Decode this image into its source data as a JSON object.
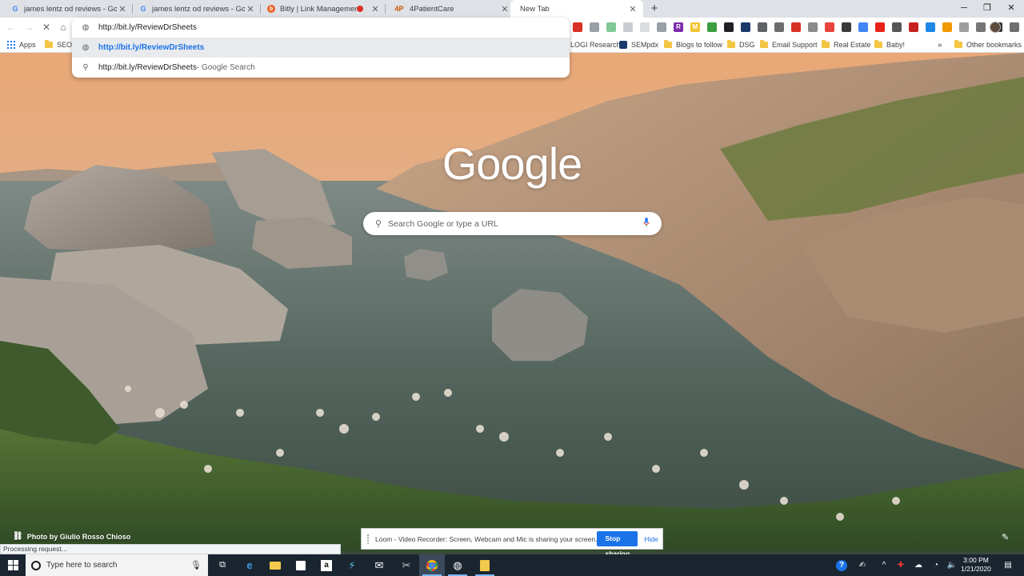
{
  "tabs": [
    {
      "title": "james lentz od reviews - Google S",
      "favicon": "G"
    },
    {
      "title": "james lentz od reviews - Google S",
      "favicon": "G"
    },
    {
      "title": "Bitly | Link Management",
      "favicon": "b"
    },
    {
      "title": "4PatientCare",
      "favicon": "4P"
    },
    {
      "title": "New Tab",
      "favicon": ""
    }
  ],
  "omnibox": {
    "value": "http://bit.ly/ReviewDrSheets",
    "suggestions": [
      {
        "text": "http://bit.ly/ReviewDrSheets",
        "desc": ""
      },
      {
        "text": "http://bit.ly/ReviewDrSheets",
        "desc": " - Google Search"
      }
    ]
  },
  "extensions": [
    {
      "icon": "record-icon",
      "glyph": "",
      "color": "#d93025"
    },
    {
      "icon": "ext-code-icon",
      "glyph": "",
      "color": "#9aa0a6"
    },
    {
      "icon": "ext-audio-icon",
      "glyph": "",
      "color": "#81c995"
    },
    {
      "icon": "ext-zoom-icon",
      "glyph": "",
      "color": "#c8ccd0"
    },
    {
      "icon": "ext-slash-icon",
      "glyph": "",
      "color": "#dadce0"
    },
    {
      "icon": "ext-k-icon",
      "glyph": "",
      "color": "#9aa0a6"
    },
    {
      "icon": "ext-r-icon",
      "glyph": "R",
      "color": "#7b2ca8"
    },
    {
      "icon": "ext-m-icon",
      "glyph": "M",
      "color": "#f1c232"
    },
    {
      "icon": "ext-n-icon",
      "glyph": "",
      "color": "#3d9c40"
    },
    {
      "icon": "ext-page-icon",
      "glyph": "",
      "color": "#202124"
    },
    {
      "icon": "ext-monitor-icon",
      "glyph": "",
      "color": "#1a3a6b"
    },
    {
      "icon": "ext-lock-icon",
      "glyph": "",
      "color": "#5f6368"
    },
    {
      "icon": "ext-circle-icon",
      "glyph": "",
      "color": "#6d6d6d"
    },
    {
      "icon": "ext-stop-icon",
      "glyph": "",
      "color": "#d93025"
    },
    {
      "icon": "ext-g-icon",
      "glyph": "",
      "color": "#8a8a8a"
    },
    {
      "icon": "ext-puzzle-icon",
      "glyph": "",
      "color": "#e8453c"
    },
    {
      "icon": "ext-ring-icon",
      "glyph": "",
      "color": "#3a3a3a"
    },
    {
      "icon": "ext-cloud-icon",
      "glyph": "",
      "color": "#4285f4"
    },
    {
      "icon": "ext-youtube-icon",
      "glyph": "",
      "color": "#e62117"
    },
    {
      "icon": "ext-box-icon",
      "glyph": "",
      "color": "#555555"
    },
    {
      "icon": "ext-chrome-icon",
      "glyph": "",
      "color": "#c5221f"
    },
    {
      "icon": "ext-blue-icon",
      "glyph": "",
      "color": "#1e88e5"
    },
    {
      "icon": "ext-gear-icon",
      "glyph": "",
      "color": "#f29900"
    },
    {
      "icon": "ext-grey-icon",
      "glyph": "",
      "color": "#9e9e9e"
    },
    {
      "icon": "ext-photo-icon",
      "glyph": "",
      "color": "#757575"
    },
    {
      "icon": "ext-frame-icon",
      "glyph": "",
      "color": "#303030"
    },
    {
      "icon": "ext-last-icon",
      "glyph": "",
      "color": "#6f6f6f"
    }
  ],
  "bookmarks": [
    {
      "label": "Apps",
      "icon": "apps-grid-icon"
    },
    {
      "label": "SEO A",
      "icon": "folder-icon"
    },
    {
      "label": "LOGI Research",
      "icon": "folder-icon"
    },
    {
      "label": "SEMpdx",
      "icon": "semrush-icon"
    },
    {
      "label": "Blogs to follow",
      "icon": "folder-icon"
    },
    {
      "label": "DSG",
      "icon": "folder-icon"
    },
    {
      "label": "Email Support",
      "icon": "folder-icon"
    },
    {
      "label": "Real Estate",
      "icon": "folder-icon"
    },
    {
      "label": "Baby!",
      "icon": "folder-icon"
    },
    {
      "label": "Other bookmarks",
      "icon": "folder-icon"
    }
  ],
  "ntp": {
    "logo": "Google",
    "search_placeholder": "Search Google or type a URL",
    "photo_credit": "Photo by Giulio Rosso Chioso"
  },
  "status": "Processing request...",
  "loom": {
    "message": "Loom - Video Recorder: Screen, Webcam and Mic is sharing your screen.",
    "stop_label": "Stop sharing",
    "hide_label": "Hide"
  },
  "taskbar": {
    "search_placeholder": "Type here to search",
    "time": "3:00 PM",
    "date": "1/21/2020"
  },
  "colors": {
    "accent": "#1a73e8",
    "tab_strip": "#dee1e6",
    "taskbar": "#1b2530"
  }
}
